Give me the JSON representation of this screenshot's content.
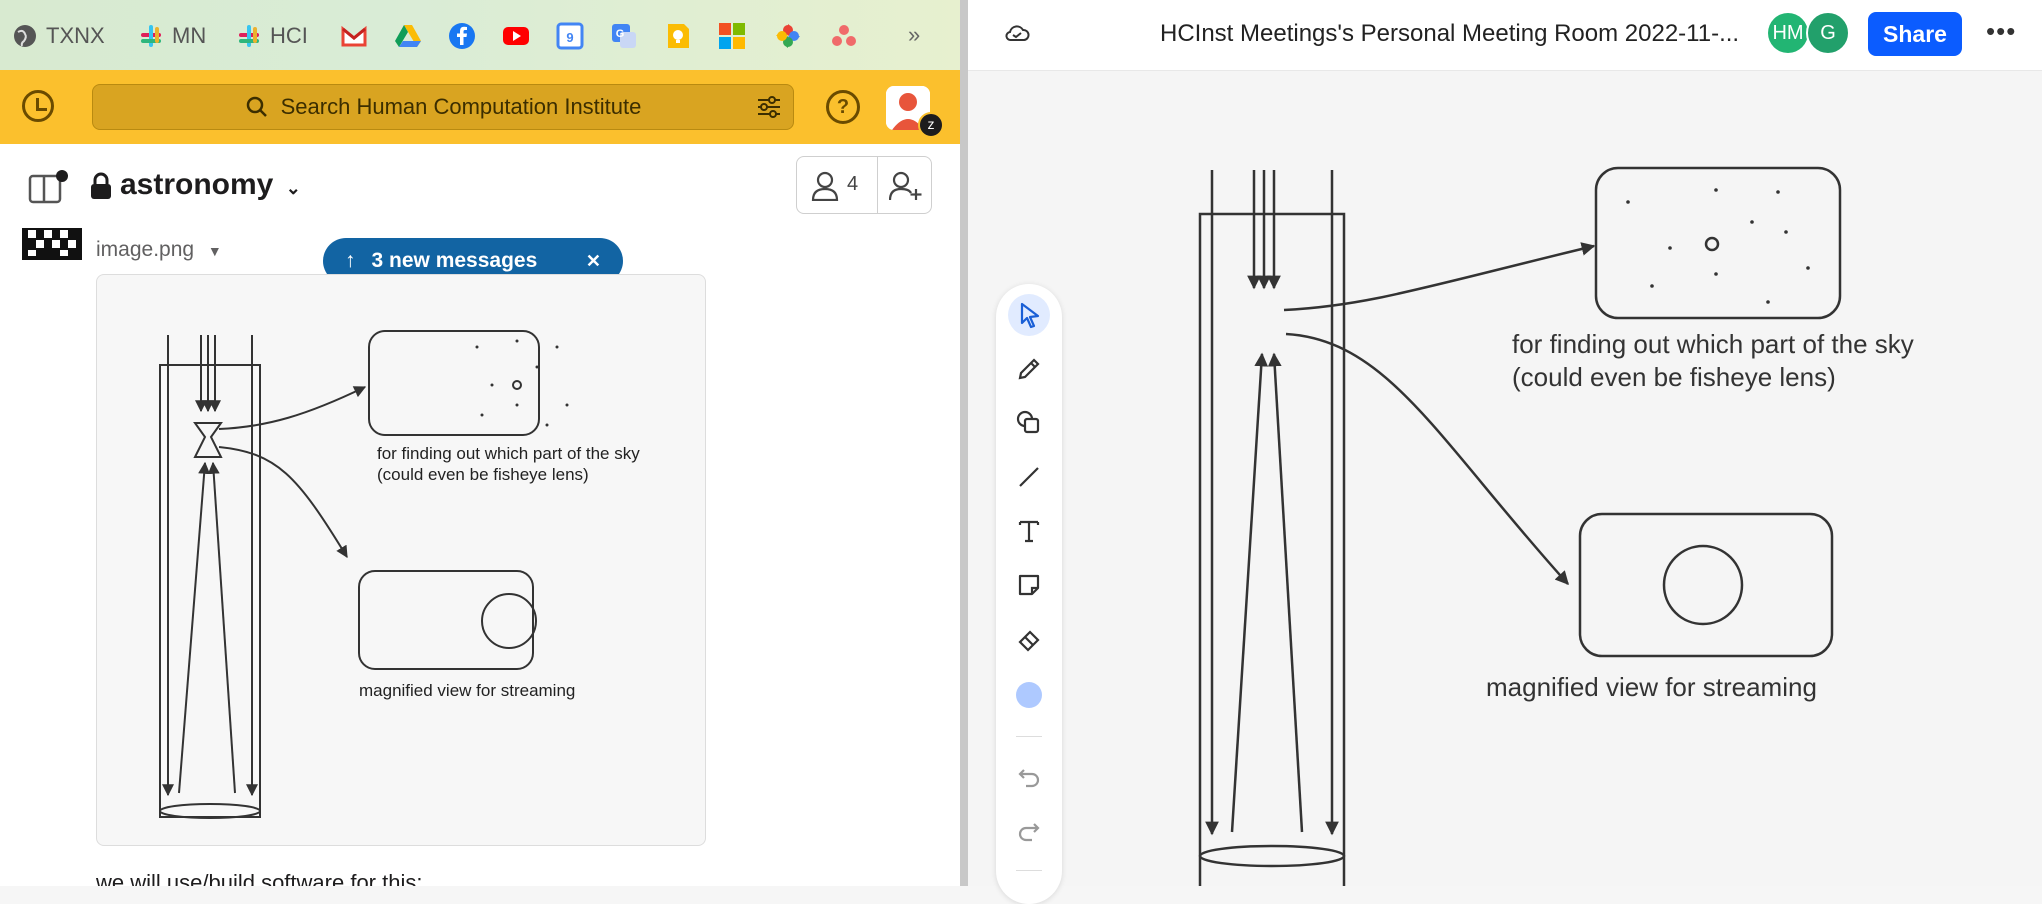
{
  "bookmarks": {
    "items": [
      {
        "label": "TXNX",
        "icon": "globe-icon"
      },
      {
        "label": "MN",
        "icon": "slack-icon"
      },
      {
        "label": "HCI",
        "icon": "slack-icon"
      }
    ],
    "app_icons": [
      "gmail-icon",
      "drive-icon",
      "facebook-icon",
      "youtube-icon",
      "calendar-icon",
      "translate-icon",
      "keep-icon",
      "microsoft-icon",
      "photos-icon",
      "asana-icon"
    ],
    "more": "»"
  },
  "slack": {
    "search_placeholder": "Search Human Computation Institute",
    "channel": "astronomy",
    "member_count": "4",
    "file_name": "image.png",
    "new_messages": "3 new messages",
    "close": "✕",
    "footer_text": "we will use/build software for this:",
    "diagram": {
      "label_sky": [
        "for finding out which part of the sky",
        "(could even be fisheye lens)"
      ],
      "label_stream": "magnified view for streaming"
    }
  },
  "whiteboard": {
    "title": "HCInst Meetings's Personal Meeting Room 2022-11-...",
    "avatars": [
      {
        "initials": "HM",
        "color": "#22b573"
      },
      {
        "initials": "G",
        "color": "#22a06b"
      }
    ],
    "share_label": "Share",
    "more_label": "•••",
    "tools": [
      "select-icon",
      "pen-icon",
      "shapes-icon",
      "line-icon",
      "text-icon",
      "sticky-note-icon",
      "eraser-icon",
      "color-swatch",
      "undo-icon",
      "redo-icon"
    ],
    "label_sky": [
      "for finding out which part of the sky",
      "(could even be fisheye lens)"
    ],
    "label_stream": "magnified view for streaming"
  }
}
